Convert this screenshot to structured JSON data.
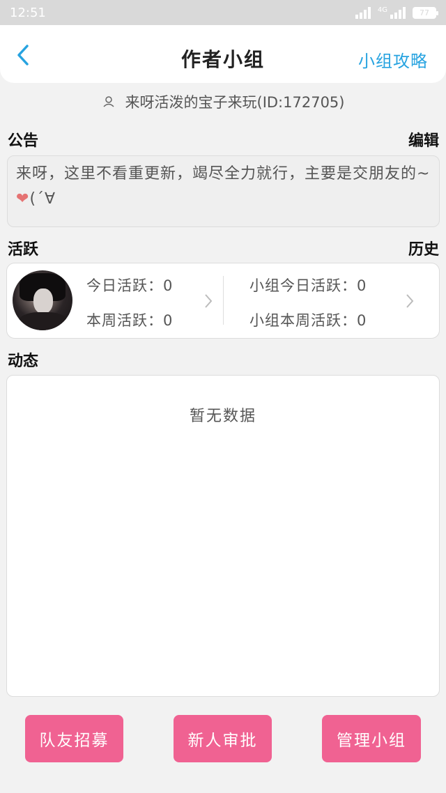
{
  "status_bar": {
    "time": "12:51",
    "network": "4G",
    "battery": "77"
  },
  "header": {
    "title": "作者小组",
    "action_label": "小组攻略"
  },
  "owner": {
    "text": "来呀活泼的宝子来玩(ID:172705)"
  },
  "notice": {
    "title": "公告",
    "edit_label": "编辑",
    "content": "来呀，这里不看重更新，竭尽全力就行，主要是交朋友的~",
    "emoji_tail": "(´∀"
  },
  "activity": {
    "title": "活跃",
    "history_label": "历史",
    "today_label": "今日活跃：0",
    "week_label": "本周活跃：0",
    "group_today_label": "小组今日活跃：0",
    "group_week_label": "小组本周活跃：0"
  },
  "feed": {
    "title": "动态",
    "empty_text": "暂无数据"
  },
  "buttons": {
    "recruit": "队友招募",
    "approve": "新人审批",
    "manage": "管理小组"
  },
  "colors": {
    "accent_blue": "#27a3e0",
    "button_pink": "#f06292"
  }
}
